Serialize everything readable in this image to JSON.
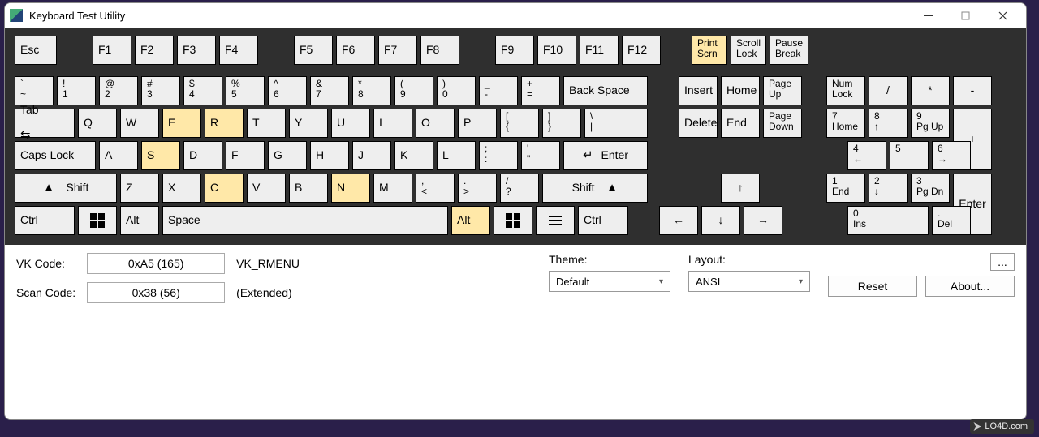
{
  "title": "Keyboard Test Utility",
  "watermark": "LO4D.com",
  "rows": {
    "fn": {
      "esc": "Esc",
      "f": [
        "F1",
        "F2",
        "F3",
        "F4",
        "F5",
        "F6",
        "F7",
        "F8",
        "F9",
        "F10",
        "F11",
        "F12"
      ],
      "print": [
        "Print",
        "Scrn"
      ],
      "scroll": [
        "Scroll",
        "Lock"
      ],
      "pause": [
        "Pause",
        "Break"
      ]
    },
    "num": {
      "keys": [
        [
          "`",
          "~"
        ],
        [
          "!",
          "1"
        ],
        [
          "@",
          "2"
        ],
        [
          "#",
          "3"
        ],
        [
          "$",
          "4"
        ],
        [
          "%",
          "5"
        ],
        [
          "^",
          "6"
        ],
        [
          "&",
          "7"
        ],
        [
          "*",
          "8"
        ],
        [
          "(",
          "9"
        ],
        [
          ")",
          "0"
        ],
        [
          "_",
          "-"
        ],
        [
          "+",
          "="
        ]
      ],
      "back": "Back Space",
      "nav": [
        "Insert",
        "Home",
        [
          "Page",
          "Up"
        ]
      ],
      "numlock": [
        "Num",
        "Lock"
      ],
      "ops": [
        "/",
        "*",
        "-"
      ]
    },
    "qwer": {
      "tab": "Tab",
      "letters": [
        "Q",
        "W",
        "E",
        "R",
        "T",
        "Y",
        "U",
        "I",
        "O",
        "P"
      ],
      "br1": [
        "[",
        "{"
      ],
      "br2": [
        "]",
        "}"
      ],
      "bslash": [
        "\\",
        "|"
      ],
      "nav": [
        "Delete",
        "End",
        [
          "Page",
          "Down"
        ]
      ],
      "num": [
        [
          "7",
          "Home"
        ],
        [
          "8",
          "↑"
        ],
        [
          "9",
          "Pg Up"
        ]
      ],
      "plus": "+"
    },
    "asdf": {
      "caps": "Caps Lock",
      "letters": [
        "A",
        "S",
        "D",
        "F",
        "G",
        "H",
        "J",
        "K",
        "L"
      ],
      "semi": [
        ";",
        ":"
      ],
      "quote": [
        "'",
        "\""
      ],
      "enter": "Enter",
      "num": [
        [
          "4",
          "←"
        ],
        [
          "5",
          ""
        ],
        [
          "6",
          "→"
        ]
      ]
    },
    "zxcv": {
      "shift": "Shift",
      "letters": [
        "Z",
        "X",
        "C",
        "V",
        "B",
        "N",
        "M"
      ],
      "comma": [
        ",",
        "<"
      ],
      "period": [
        ".",
        ">"
      ],
      "slash": [
        "/",
        "?"
      ],
      "shift2": "Shift",
      "up": "↑",
      "num": [
        [
          "1",
          "End"
        ],
        [
          "2",
          "↓"
        ],
        [
          "3",
          "Pg Dn"
        ]
      ],
      "numEnter": "Enter"
    },
    "bot": {
      "ctrl": "Ctrl",
      "alt": "Alt",
      "space": "Space",
      "alt2": "Alt",
      "ctrl2": "Ctrl",
      "arrows": [
        "←",
        "↓",
        "→"
      ],
      "num": [
        [
          "0",
          "Ins"
        ],
        [
          ".",
          "Del"
        ]
      ]
    }
  },
  "highlighted": [
    "print",
    "E",
    "R",
    "S",
    "C",
    "N",
    "alt2"
  ],
  "status": {
    "vk_label": "VK Code:",
    "vk_value": "0xA5 (165)",
    "vk_name": "VK_RMENU",
    "scan_label": "Scan Code:",
    "scan_value": "0x38 (56)",
    "scan_extra": "(Extended)"
  },
  "controls": {
    "theme_label": "Theme:",
    "theme_value": "Default",
    "layout_label": "Layout:",
    "layout_value": "ANSI",
    "reset": "Reset",
    "about": "About...",
    "dots": "..."
  }
}
